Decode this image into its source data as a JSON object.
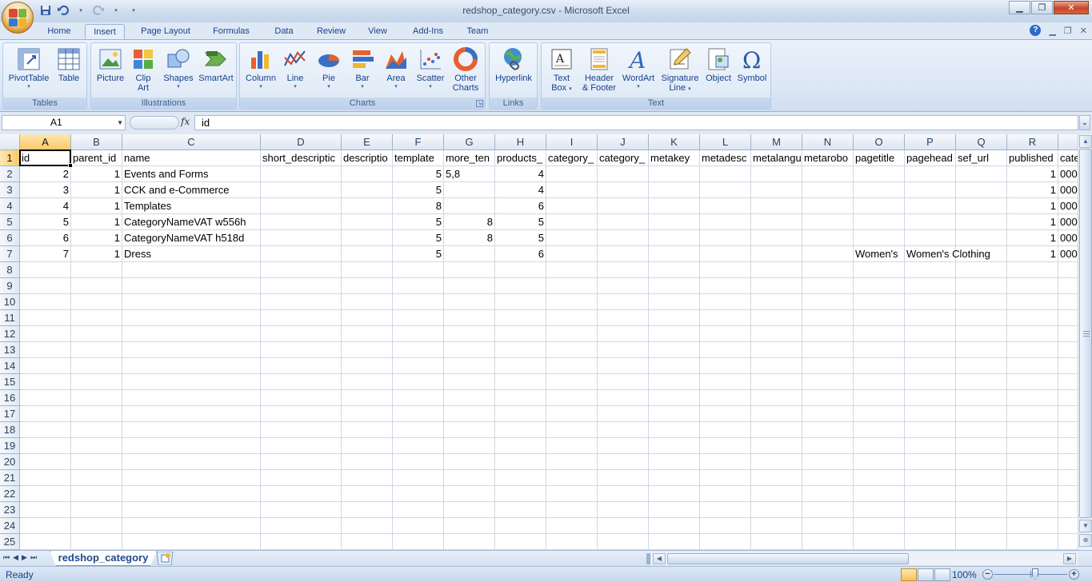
{
  "window": {
    "title": "redshop_category.csv - Microsoft Excel",
    "controls": [
      "minimize",
      "maximize",
      "close"
    ]
  },
  "ribbon_tabs": [
    {
      "label": "Home",
      "active": false
    },
    {
      "label": "Insert",
      "active": true
    },
    {
      "label": "Page Layout",
      "active": false
    },
    {
      "label": "Formulas",
      "active": false
    },
    {
      "label": "Data",
      "active": false
    },
    {
      "label": "Review",
      "active": false
    },
    {
      "label": "View",
      "active": false
    },
    {
      "label": "Add-Ins",
      "active": false
    },
    {
      "label": "Team",
      "active": false
    }
  ],
  "ribbon": {
    "groups": [
      {
        "label": "Tables",
        "buttons": [
          {
            "label": "PivotTable",
            "dropdown": true,
            "icon": "pivot-table-icon"
          },
          {
            "label": "Table",
            "icon": "table-icon"
          }
        ]
      },
      {
        "label": "Illustrations",
        "buttons": [
          {
            "label": "Picture",
            "icon": "picture-icon"
          },
          {
            "label": "Clip Art",
            "line1": "Clip",
            "line2": "Art",
            "icon": "clip-art-icon"
          },
          {
            "label": "Shapes",
            "dropdown": true,
            "icon": "shapes-icon"
          },
          {
            "label": "SmartArt",
            "icon": "smartart-icon"
          }
        ]
      },
      {
        "label": "Charts",
        "buttons": [
          {
            "label": "Column",
            "dropdown": true,
            "icon": "column-chart-icon"
          },
          {
            "label": "Line",
            "dropdown": true,
            "icon": "line-chart-icon"
          },
          {
            "label": "Pie",
            "dropdown": true,
            "icon": "pie-chart-icon"
          },
          {
            "label": "Bar",
            "dropdown": true,
            "icon": "bar-chart-icon"
          },
          {
            "label": "Area",
            "dropdown": true,
            "icon": "area-chart-icon"
          },
          {
            "label": "Scatter",
            "dropdown": true,
            "icon": "scatter-chart-icon"
          },
          {
            "label": "Other Charts",
            "line1": "Other",
            "line2": "Charts",
            "dropdown": true,
            "icon": "other-charts-icon"
          }
        ]
      },
      {
        "label": "Links",
        "buttons": [
          {
            "label": "Hyperlink",
            "icon": "hyperlink-icon"
          }
        ]
      },
      {
        "label": "Text",
        "buttons": [
          {
            "label": "Text Box",
            "line1": "Text",
            "line2": "Box",
            "dropdown": true,
            "icon": "text-box-icon"
          },
          {
            "label": "Header & Footer",
            "line1": "Header",
            "line2": "& Footer",
            "icon": "header-footer-icon"
          },
          {
            "label": "WordArt",
            "dropdown": true,
            "icon": "wordart-icon"
          },
          {
            "label": "Signature Line",
            "line1": "Signature",
            "line2": "Line",
            "dropdown": true,
            "icon": "signature-line-icon"
          },
          {
            "label": "Object",
            "icon": "object-icon"
          },
          {
            "label": "Symbol",
            "icon": "symbol-icon"
          }
        ]
      }
    ]
  },
  "formula_bar": {
    "name_box": "A1",
    "fx_label": "fx",
    "value": "id"
  },
  "sheet": {
    "columns": [
      "A",
      "B",
      "C",
      "D",
      "E",
      "F",
      "G",
      "H",
      "I",
      "J",
      "K",
      "L",
      "M",
      "N",
      "O",
      "P",
      "Q",
      "R",
      ""
    ],
    "selected_column": "A",
    "selected_row": "1",
    "active_cell": "A1",
    "rows": [
      "1",
      "2",
      "3",
      "4",
      "5",
      "6",
      "7",
      "8",
      "9",
      "10",
      "11",
      "12",
      "13",
      "14",
      "15",
      "16",
      "17",
      "18",
      "19",
      "20",
      "21",
      "22",
      "23",
      "24",
      "25"
    ],
    "headers": [
      "id",
      "parent_id",
      "name",
      "short_descriptic",
      "descriptio",
      "template",
      "more_ten",
      "products_",
      "category_",
      "category_",
      "metakey",
      "metadesc",
      "metalangu",
      "metarobo",
      "pagetitle",
      "pagehead",
      "sef_url",
      "published",
      "cate"
    ],
    "data": [
      [
        "2",
        "1",
        "Events and Forms",
        "",
        "",
        "5",
        "5,8",
        "4",
        "",
        "",
        "",
        "",
        "",
        "",
        "",
        "",
        "",
        "1",
        "000"
      ],
      [
        "3",
        "1",
        "CCK and e-Commerce",
        "",
        "",
        "5",
        "",
        "4",
        "",
        "",
        "",
        "",
        "",
        "",
        "",
        "",
        "",
        "1",
        "000"
      ],
      [
        "4",
        "1",
        "Templates",
        "",
        "",
        "8",
        "",
        "6",
        "",
        "",
        "",
        "",
        "",
        "",
        "",
        "",
        "",
        "1",
        "000"
      ],
      [
        "5",
        "1",
        "CategoryNameVAT w556h",
        "",
        "",
        "5",
        "8",
        "5",
        "",
        "",
        "",
        "",
        "",
        "",
        "",
        "",
        "",
        "1",
        "000"
      ],
      [
        "6",
        "1",
        "CategoryNameVAT h518d",
        "",
        "",
        "5",
        "8",
        "5",
        "",
        "",
        "",
        "",
        "",
        "",
        "",
        "",
        "",
        "1",
        "000"
      ],
      [
        "7",
        "1",
        "Dress",
        "",
        "",
        "5",
        "",
        "6",
        "",
        "",
        "",
        "",
        "",
        "",
        "Women's",
        "Women's Clothing",
        "",
        "1",
        "000"
      ]
    ]
  },
  "sheet_tabs": [
    {
      "label": "redshop_category",
      "active": true
    }
  ],
  "status": {
    "text": "Ready",
    "zoom": "100%",
    "zoom_minus": "−",
    "zoom_plus": "+"
  },
  "colors": {
    "selected_header": "#f9c96a",
    "gridline": "#d0d7e5",
    "ribbon_text": "#15428b"
  }
}
